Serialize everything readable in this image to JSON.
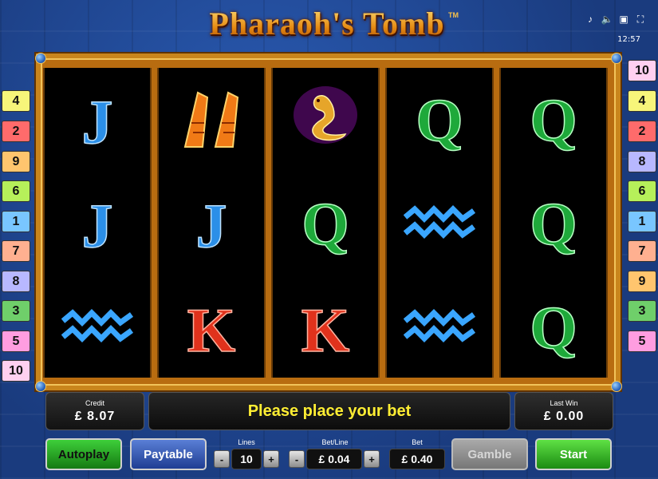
{
  "game": {
    "title": "Pharaoh's Tomb",
    "trademark": "TM"
  },
  "status_bar": {
    "icons": [
      "music-icon",
      "sound-icon",
      "dice-icon",
      "fullscreen-icon"
    ],
    "time": "12:57"
  },
  "reels": [
    [
      "J",
      "J",
      "wave"
    ],
    [
      "ankh-feathers",
      "J",
      "K"
    ],
    [
      "cobra",
      "Q",
      "K"
    ],
    [
      "Q",
      "wave",
      "wave"
    ],
    [
      "Q",
      "Q",
      "Q"
    ]
  ],
  "line_markers_left": [
    "4",
    "2",
    "9",
    "6",
    "1",
    "7",
    "8",
    "3",
    "5",
    "10"
  ],
  "line_markers_right": [
    "10",
    "4",
    "2",
    "8",
    "6",
    "1",
    "7",
    "9",
    "3",
    "5"
  ],
  "line_colors": {
    "1": "#79c6ff",
    "2": "#ff6b6b",
    "3": "#6fcf6a",
    "4": "#f7f57a",
    "5": "#ff9de0",
    "6": "#b6f05a",
    "7": "#ffb090",
    "8": "#b8b8ff",
    "9": "#ffc56e",
    "10": "#ffd0f0"
  },
  "credit": {
    "label": "Credit",
    "value": "£ 8.07"
  },
  "message": "Please place your bet",
  "last_win": {
    "label": "Last Win",
    "value": "£ 0.00"
  },
  "buttons": {
    "autoplay": "Autoplay",
    "paytable": "Paytable",
    "gamble": "Gamble",
    "start": "Start"
  },
  "lines": {
    "label": "Lines",
    "value": "10"
  },
  "bet_line": {
    "label": "Bet/Line",
    "value": "£ 0.04"
  },
  "bet": {
    "label": "Bet",
    "value": "£ 0.40"
  },
  "controls": {
    "minus": "-",
    "plus": "+"
  }
}
